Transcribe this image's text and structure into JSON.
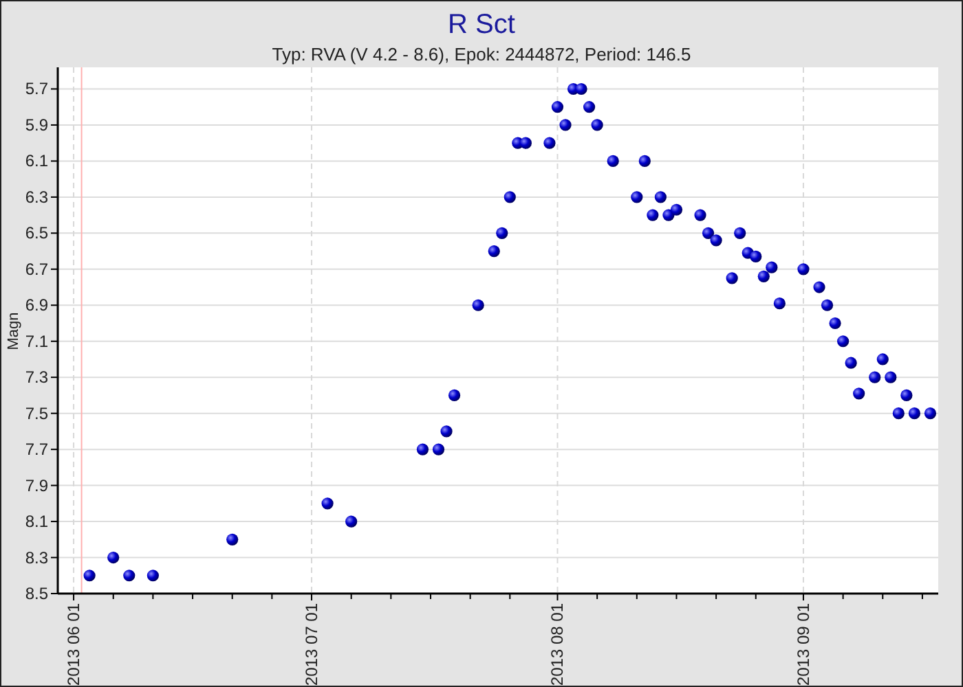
{
  "chart_data": {
    "type": "scatter",
    "title": "R Sct",
    "subtitle": "Typ: RVA (V 4.2 - 8.6), Epok: 2444872, Period: 146.5",
    "ylabel": "Magn",
    "xlim": [
      "2013-05-30",
      "2013-09-18"
    ],
    "ylim": [
      8.5,
      5.58
    ],
    "xticks": [
      {
        "value": "2013-06-01",
        "label": "2013 06 01"
      },
      {
        "value": "2013-07-01",
        "label": "2013 07 01"
      },
      {
        "value": "2013-08-01",
        "label": "2013 08 01"
      },
      {
        "value": "2013-09-01",
        "label": "2013 09 01"
      }
    ],
    "yticks": [
      {
        "value": 5.7,
        "label": "5.7"
      },
      {
        "value": 5.9,
        "label": "5.9"
      },
      {
        "value": 6.1,
        "label": "6.1"
      },
      {
        "value": 6.3,
        "label": "6.3"
      },
      {
        "value": 6.5,
        "label": "6.5"
      },
      {
        "value": 6.7,
        "label": "6.7"
      },
      {
        "value": 6.9,
        "label": "6.9"
      },
      {
        "value": 7.1,
        "label": "7.1"
      },
      {
        "value": 7.3,
        "label": "7.3"
      },
      {
        "value": 7.5,
        "label": "7.5"
      },
      {
        "value": 7.7,
        "label": "7.7"
      },
      {
        "value": 7.9,
        "label": "7.9"
      },
      {
        "value": 8.1,
        "label": "8.1"
      },
      {
        "value": 8.3,
        "label": "8.3"
      },
      {
        "value": 8.5,
        "label": "8.5"
      }
    ],
    "grid": true,
    "ref_lines": [
      {
        "axis": "x",
        "value": "2013-06-02"
      }
    ],
    "series": [
      {
        "color": "#0000cc",
        "x": [
          "2013-06-03",
          "2013-06-06",
          "2013-06-08",
          "2013-06-11",
          "2013-06-21",
          "2013-07-03",
          "2013-07-06",
          "2013-07-15",
          "2013-07-17",
          "2013-07-18",
          "2013-07-19",
          "2013-07-22",
          "2013-07-24",
          "2013-07-25",
          "2013-07-26",
          "2013-07-27",
          "2013-07-28",
          "2013-07-31",
          "2013-08-01",
          "2013-08-02",
          "2013-08-03",
          "2013-08-04",
          "2013-08-05",
          "2013-08-06",
          "2013-08-08",
          "2013-08-11",
          "2013-08-12",
          "2013-08-13",
          "2013-08-14",
          "2013-08-15",
          "2013-08-16",
          "2013-08-19",
          "2013-08-20",
          "2013-08-21",
          "2013-08-23",
          "2013-08-24",
          "2013-08-25",
          "2013-08-26",
          "2013-08-27",
          "2013-08-28",
          "2013-08-29",
          "2013-09-01",
          "2013-09-03",
          "2013-09-04",
          "2013-09-05",
          "2013-09-06",
          "2013-09-07",
          "2013-09-08",
          "2013-09-10",
          "2013-09-11",
          "2013-09-12",
          "2013-09-13",
          "2013-09-14",
          "2013-09-15",
          "2013-09-17"
        ],
        "values": [
          8.4,
          8.3,
          8.4,
          8.4,
          8.2,
          8.0,
          8.1,
          7.7,
          7.7,
          7.6,
          7.4,
          6.9,
          6.6,
          6.5,
          6.3,
          6.0,
          6.0,
          6.0,
          5.8,
          5.9,
          5.7,
          5.7,
          5.8,
          5.9,
          6.1,
          6.3,
          6.1,
          6.4,
          6.3,
          6.4,
          6.37,
          6.4,
          6.5,
          6.54,
          6.75,
          6.5,
          6.61,
          6.63,
          6.74,
          6.69,
          6.89,
          6.7,
          6.8,
          6.9,
          7.0,
          7.1,
          7.22,
          7.39,
          7.3,
          7.2,
          7.3,
          7.5,
          7.4,
          7.5,
          7.5
        ]
      }
    ]
  }
}
